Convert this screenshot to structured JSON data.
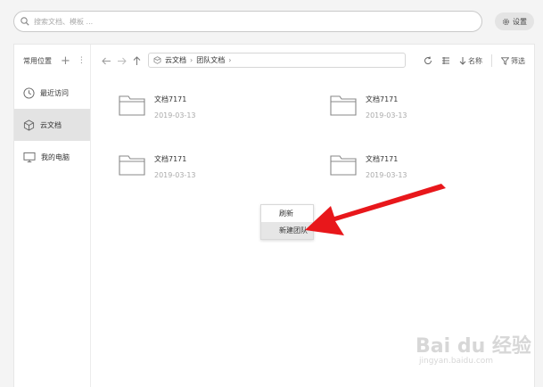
{
  "search": {
    "placeholder": "搜索文档、模板 ..."
  },
  "settings": {
    "label": "设置"
  },
  "sidebar": {
    "header": "常用位置",
    "items": [
      {
        "label": "最近访问",
        "icon": "clock-icon"
      },
      {
        "label": "云文档",
        "icon": "cube-icon"
      },
      {
        "label": "我的电脑",
        "icon": "monitor-icon"
      }
    ]
  },
  "toolbar": {
    "path": [
      "云文档",
      "团队文档"
    ],
    "sort_label": "名称",
    "filter_label": "筛选"
  },
  "files": [
    {
      "name": "文档7171",
      "date": "2019-03-13"
    },
    {
      "name": "文档7171",
      "date": "2019-03-13"
    },
    {
      "name": "文档7171",
      "date": "2019-03-13"
    },
    {
      "name": "文档7171",
      "date": "2019-03-13"
    }
  ],
  "context_menu": {
    "items": [
      "刷新",
      "新建团队"
    ]
  },
  "annotation": {
    "arrow_color": "#e8171b"
  },
  "watermark": {
    "brand": "Bai du 经验",
    "url": "jingyan.baidu.com"
  }
}
